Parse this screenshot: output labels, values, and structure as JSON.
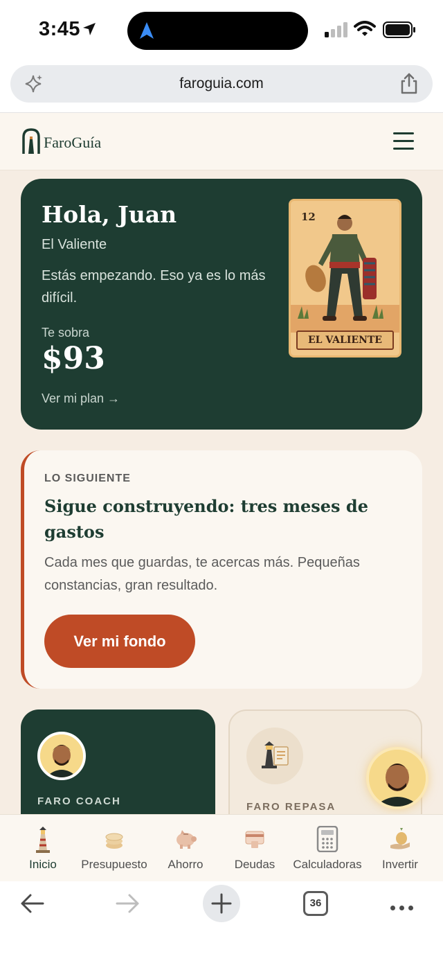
{
  "status": {
    "time": "3:45"
  },
  "browser": {
    "url": "faroguia.com",
    "tab_count": "36"
  },
  "site": {
    "brand": "FaroGuía"
  },
  "hero": {
    "greeting": "Hola, Juan",
    "title": "El Valiente",
    "message": "Estás empezando. Eso ya es lo más difícil.",
    "leftover_label": "Te sobra",
    "leftover_amount": "$93",
    "plan_link": "Ver mi plan →",
    "card": {
      "number": "12",
      "name": "EL VALIENTE"
    }
  },
  "next_step": {
    "kicker": "LO SIGUIENTE",
    "title": "Sigue construyendo: tres meses de gastos",
    "body": "Cada mes que guardas, te acercas más. Pequeñas constancias, gran resultado.",
    "button": "Ver mi fondo"
  },
  "tiles": {
    "coach_label": "FARO COACH",
    "repasa_label": "FARO REPASA"
  },
  "tabs": [
    {
      "label": "Inicio",
      "icon": "lighthouse-icon",
      "active": true
    },
    {
      "label": "Presupuesto",
      "icon": "coins-icon"
    },
    {
      "label": "Ahorro",
      "icon": "piggy-bank-icon"
    },
    {
      "label": "Deudas",
      "icon": "credit-card-icon"
    },
    {
      "label": "Calculadoras",
      "icon": "calculator-icon"
    },
    {
      "label": "Invertir",
      "icon": "money-hand-icon"
    }
  ],
  "colors": {
    "brand_green": "#1e3d32",
    "accent": "#bf4b26",
    "cream": "#f6ede3"
  }
}
